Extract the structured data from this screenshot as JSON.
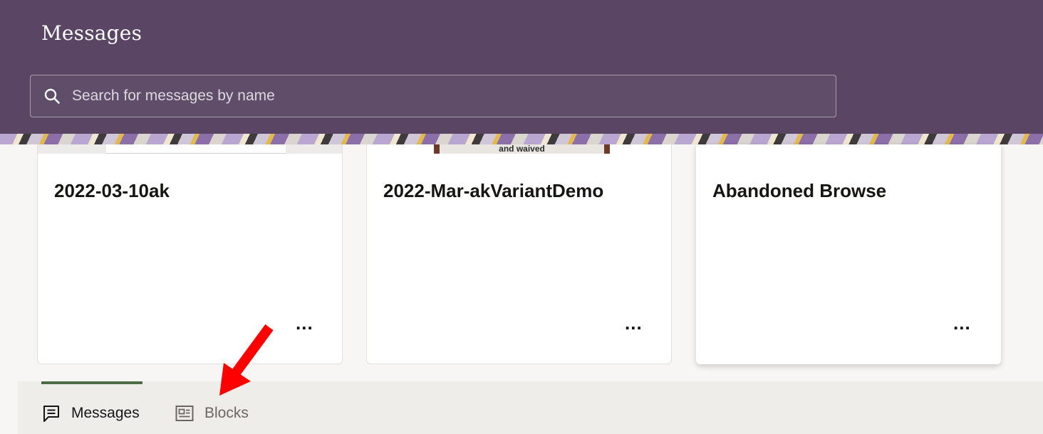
{
  "header": {
    "title": "Messages"
  },
  "search": {
    "placeholder": "Search for messages by name",
    "value": "",
    "icon": "search-icon"
  },
  "cards": [
    {
      "title": "2022-03-10ak",
      "more_label": "..."
    },
    {
      "title": "2022-Mar-akVariantDemo",
      "more_label": "...",
      "thumbnail_text": "and waived"
    },
    {
      "title": "Abandoned Browse",
      "more_label": "..."
    }
  ],
  "tabs": [
    {
      "label": "Messages",
      "icon": "chat-icon",
      "active": true
    },
    {
      "label": "Blocks",
      "icon": "blocks-icon",
      "active": false
    }
  ],
  "colors": {
    "header_bg": "#5a4664",
    "active_tab_indicator": "#4d6d45",
    "annotation_arrow": "#ff0000"
  }
}
